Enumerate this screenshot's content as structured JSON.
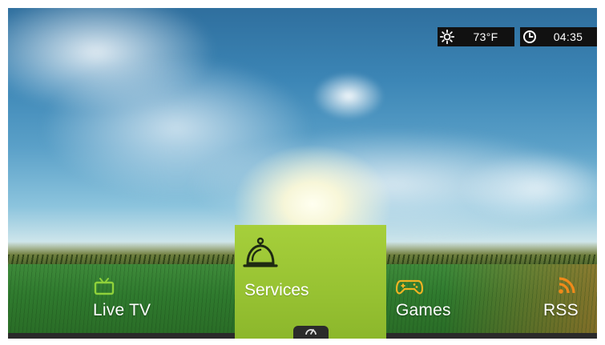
{
  "status": {
    "weather": {
      "icon": "sun-icon",
      "temperature": "73°F"
    },
    "clock": {
      "icon": "clock-icon",
      "time": "04:35"
    }
  },
  "menu": {
    "items": [
      {
        "label": "Live TV",
        "icon": "tv-icon",
        "icon_color": "#8fd13a"
      },
      {
        "label": "Services",
        "icon": "service-bell-icon",
        "icon_color": "#1e2a12",
        "selected": true
      },
      {
        "label": "Games",
        "icon": "gamepad-icon",
        "icon_color": "#f0b323"
      },
      {
        "label": "RSS",
        "icon": "rss-icon",
        "icon_color": "#f08a1a"
      }
    ],
    "selected_color": "#9cc63a"
  },
  "options_tab": {
    "icon": "gauge-icon"
  }
}
